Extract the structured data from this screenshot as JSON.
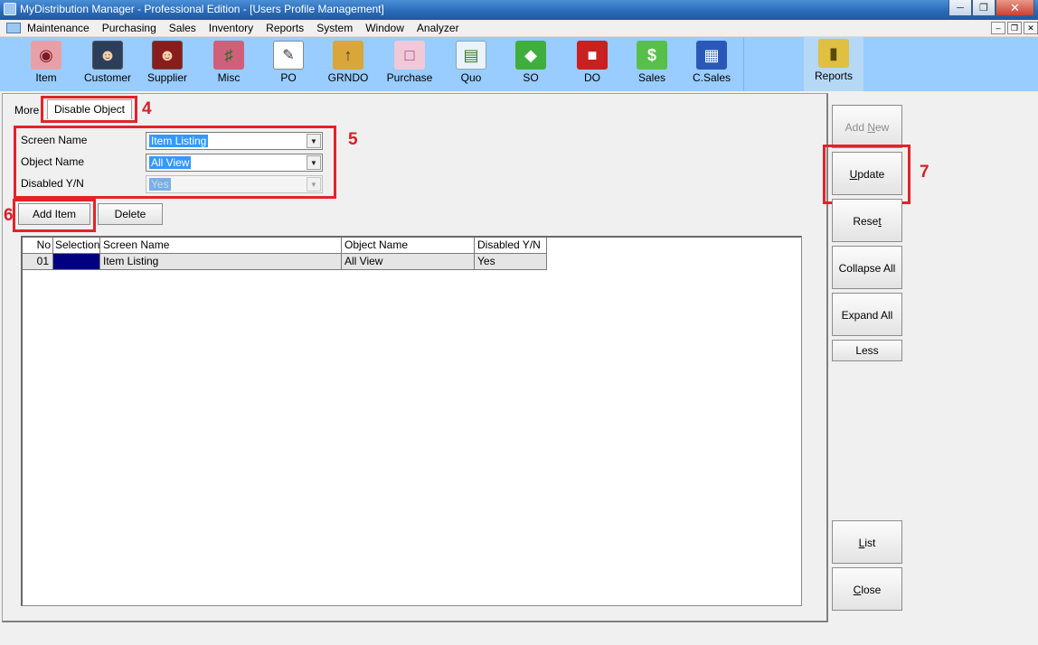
{
  "window": {
    "title": "MyDistribution Manager - Professional Edition - [Users Profile Management]",
    "controls": [
      "minimize",
      "restore",
      "close"
    ]
  },
  "menu": {
    "items": [
      "Maintenance",
      "Purchasing",
      "Sales",
      "Inventory",
      "Reports",
      "System",
      "Window",
      "Analyzer"
    ]
  },
  "toolbar": {
    "items": [
      {
        "label": "Item",
        "icon": "item-icon"
      },
      {
        "label": "Customer",
        "icon": "customer-icon"
      },
      {
        "label": "Supplier",
        "icon": "supplier-icon"
      },
      {
        "label": "Misc",
        "icon": "misc-icon"
      },
      {
        "label": "PO",
        "icon": "po-icon"
      },
      {
        "label": "GRNDO",
        "icon": "grndo-icon"
      },
      {
        "label": "Purchase",
        "icon": "purchase-icon"
      },
      {
        "label": "Quo",
        "icon": "quo-icon"
      },
      {
        "label": "SO",
        "icon": "so-icon"
      },
      {
        "label": "DO",
        "icon": "do-icon"
      },
      {
        "label": "Sales",
        "icon": "sales-icon"
      },
      {
        "label": "C.Sales",
        "icon": "cash-register-icon"
      }
    ],
    "reports_label": "Reports"
  },
  "tabs": {
    "more": "More",
    "active": "Disable Object"
  },
  "form": {
    "screen_name_label": "Screen Name",
    "screen_name_value": "Item Listing",
    "object_name_label": "Object Name",
    "object_name_value": "All View",
    "disabled_label": "Disabled Y/N",
    "disabled_value": "Yes"
  },
  "actions": {
    "add_item": "Add Item",
    "delete": "Delete"
  },
  "grid": {
    "columns": [
      "No",
      "Selection",
      "Screen Name",
      "Object Name",
      "Disabled Y/N"
    ],
    "rows": [
      {
        "no": "01",
        "selection": "",
        "screen_name": "Item Listing",
        "object_name": "All View",
        "disabled": "Yes"
      }
    ]
  },
  "side_buttons": {
    "add_new": {
      "pre": "Add ",
      "ul": "N",
      "post": "ew"
    },
    "update": {
      "pre": "",
      "ul": "U",
      "post": "pdate"
    },
    "reset": {
      "pre": "Rese",
      "ul": "t",
      "post": ""
    },
    "collapse_all": "Collapse All",
    "expand_all": "Expand All",
    "less": "Less",
    "list": {
      "pre": "",
      "ul": "L",
      "post": "ist"
    },
    "close": {
      "pre": "",
      "ul": "C",
      "post": "lose"
    }
  },
  "annotations": [
    "4",
    "5",
    "6",
    "7"
  ],
  "colors": {
    "annotation_red": "#e2232a",
    "toolbar_bg": "#99ccff",
    "selection_navy": "#000080",
    "highlight_blue": "#3399ff"
  }
}
